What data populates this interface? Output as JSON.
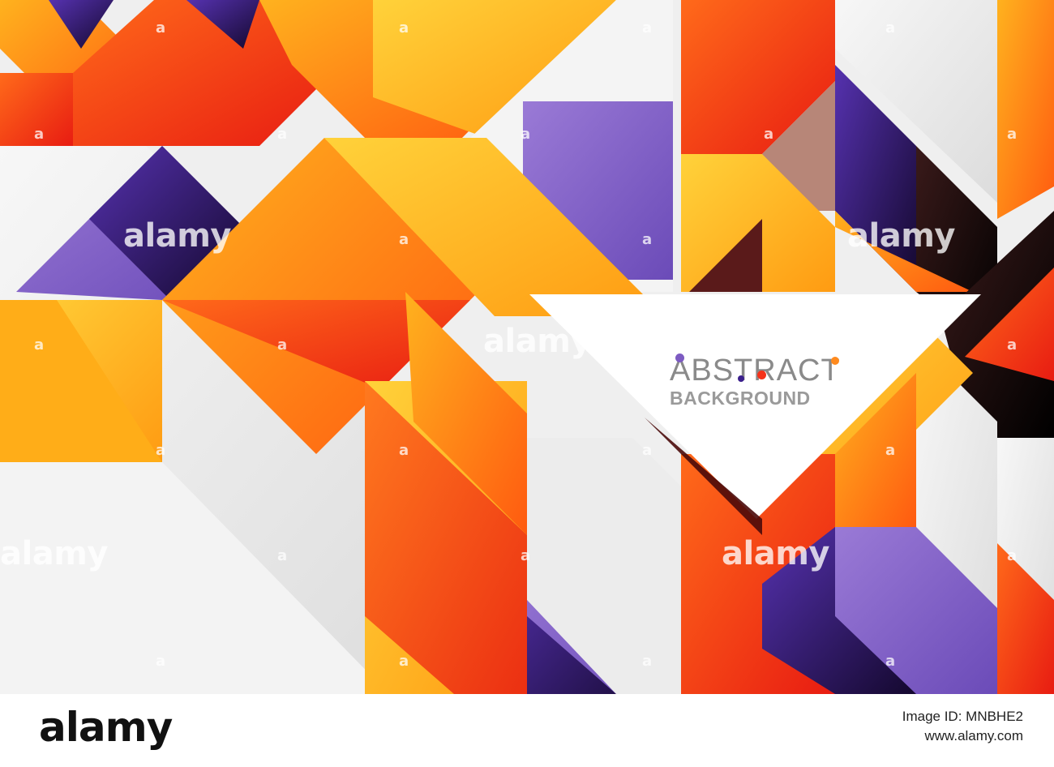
{
  "artwork": {
    "title": "ABSTRACT",
    "subtitle": "BACKGROUND",
    "colors": {
      "orange": "#ff8a1e",
      "red": "#f5321a",
      "yellow": "#ffc024",
      "purple": "#7d5bc2",
      "dark_purple": "#3b1f8c",
      "black": "#111111",
      "light_gray": "#eeeeee",
      "white": "#ffffff",
      "title_gray": "#8a8a8a"
    },
    "title_dots": [
      "#7d5bc2",
      "#f5321a",
      "#ff8a1e",
      "#3b1f8c"
    ]
  },
  "watermark": {
    "text": "alamy",
    "small_mark": "a"
  },
  "footer": {
    "logo": "alamy",
    "image_id": "Image ID: MNBHE2",
    "url": "www.alamy.com"
  }
}
